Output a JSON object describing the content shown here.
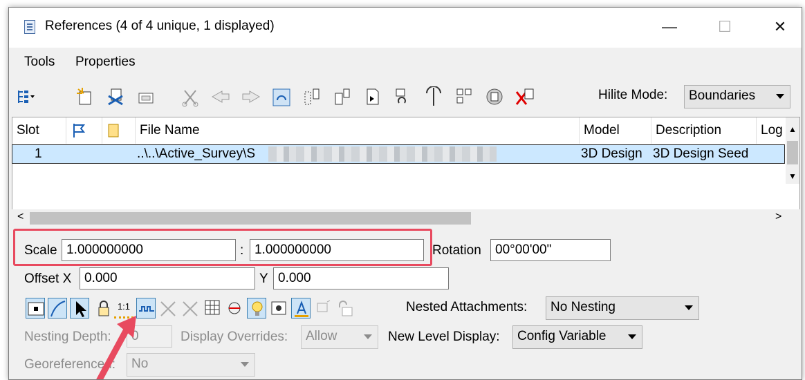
{
  "window": {
    "title": "References (4 of 4 unique, 1 displayed)",
    "minimize": "—",
    "maximize": "☐",
    "close": "✕"
  },
  "menu": {
    "tools": "Tools",
    "properties": "Properties"
  },
  "toolbar": {
    "hilite_label": "Hilite Mode:",
    "hilite_value": "Boundaries"
  },
  "table": {
    "headers": [
      "Slot",
      "",
      "",
      "File Name",
      "Model",
      "Description",
      "Log"
    ],
    "rows": [
      {
        "slot": "1",
        "file_name": "..\\..\\Active_Survey\\S",
        "model": "3D Design",
        "description": "3D Design Seed"
      }
    ]
  },
  "properties": {
    "scale_label": "Scale",
    "scale_value_1": "1.000000000",
    "scale_sep": ":",
    "scale_value_2": "1.000000000",
    "rotation_label": "Rotation",
    "rotation_value": "00°00'00\"",
    "offset_x_label": "Offset X",
    "offset_x_value": "0.000",
    "offset_y_label": "Y",
    "offset_y_value": "0.000",
    "nested_label": "Nested Attachments:",
    "nested_value": "No Nesting",
    "nesting_depth_label": "Nesting Depth:",
    "nesting_depth_value": "0",
    "display_overrides_label": "Display Overrides:",
    "display_overrides_value": "Allow",
    "new_level_label": "New Level Display:",
    "new_level_value": "Config Variable",
    "georeferenced_label": "Georeferenced:",
    "georeferenced_value": "No",
    "one_to_one_label": "1:1"
  },
  "colors": {
    "highlight_box": "#e84a5f",
    "selection": "#cce8ff"
  }
}
